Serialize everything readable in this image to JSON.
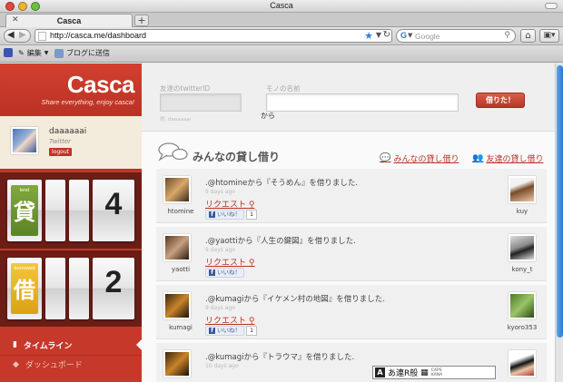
{
  "window": {
    "title": "Casca"
  },
  "tab": {
    "title": "Casca",
    "new_tab_label": "+"
  },
  "navbar": {
    "url": "http://casca.me/dashboard",
    "search_placeholder": "Google",
    "back_icon": "◀",
    "forward_icon": "▶"
  },
  "bookmarks": {
    "edit": "編集",
    "blog": "ブログに送信"
  },
  "sidebar": {
    "logo": "Casca",
    "tagline": "Share everything, enjoy casca!",
    "profile": {
      "name": "daaaaaai",
      "service": "Twitter",
      "logout": "logout"
    },
    "lend": {
      "sub": "lend",
      "kanji": "貸",
      "count": "4"
    },
    "borrow": {
      "sub": "borrowed",
      "kanji": "借",
      "count": "2"
    },
    "nav": {
      "timeline": "タイムライン",
      "dashboard": "ダッシュボード"
    }
  },
  "form": {
    "friend_label": "友達のtwitterID",
    "friend_note": "例. daaaaaai",
    "kara": "から",
    "item_label": "モノの名前",
    "submit": "借りた！"
  },
  "feed_header": {
    "title": "みんなの貸し借り",
    "link_everyone": "みんなの貸し借り",
    "link_friends": "友達の貸し借り"
  },
  "feed": [
    {
      "user": "htomine",
      "text": ".@htomineから『そうめん』を借りました.",
      "time": "9 days ago",
      "request": "リクエスト",
      "like": "いいね！",
      "like_count": "1",
      "owner": "kuy"
    },
    {
      "user": "yaotti",
      "text": ".@yaottiから『人生の鍵図』を借りました.",
      "time": "9 days ago",
      "request": "リクエスト",
      "like": "いいね！",
      "like_count": "",
      "owner": "kony_t"
    },
    {
      "user": "kumagi",
      "text": ".@kumagiから『イケメン村の地図』を借りました.",
      "time": "9 days ago",
      "request": "リクエスト",
      "like": "いいね！",
      "like_count": "1",
      "owner": "kyoro353"
    },
    {
      "user": "kumagi",
      "text": ".@kumagiから『トラウマ』を借りました.",
      "time": "10 days ago",
      "request": "",
      "like": "",
      "like_count": "",
      "owner": ""
    }
  ],
  "ime": {
    "mode": "A",
    "text": "あ連R般",
    "caps": "CAPS",
    "kana": "KANA"
  },
  "colors": {
    "brand_red": "#c6382a",
    "lend_green": "#6e9630",
    "borrow_yellow": "#e8b424",
    "link_red": "#b53327"
  }
}
